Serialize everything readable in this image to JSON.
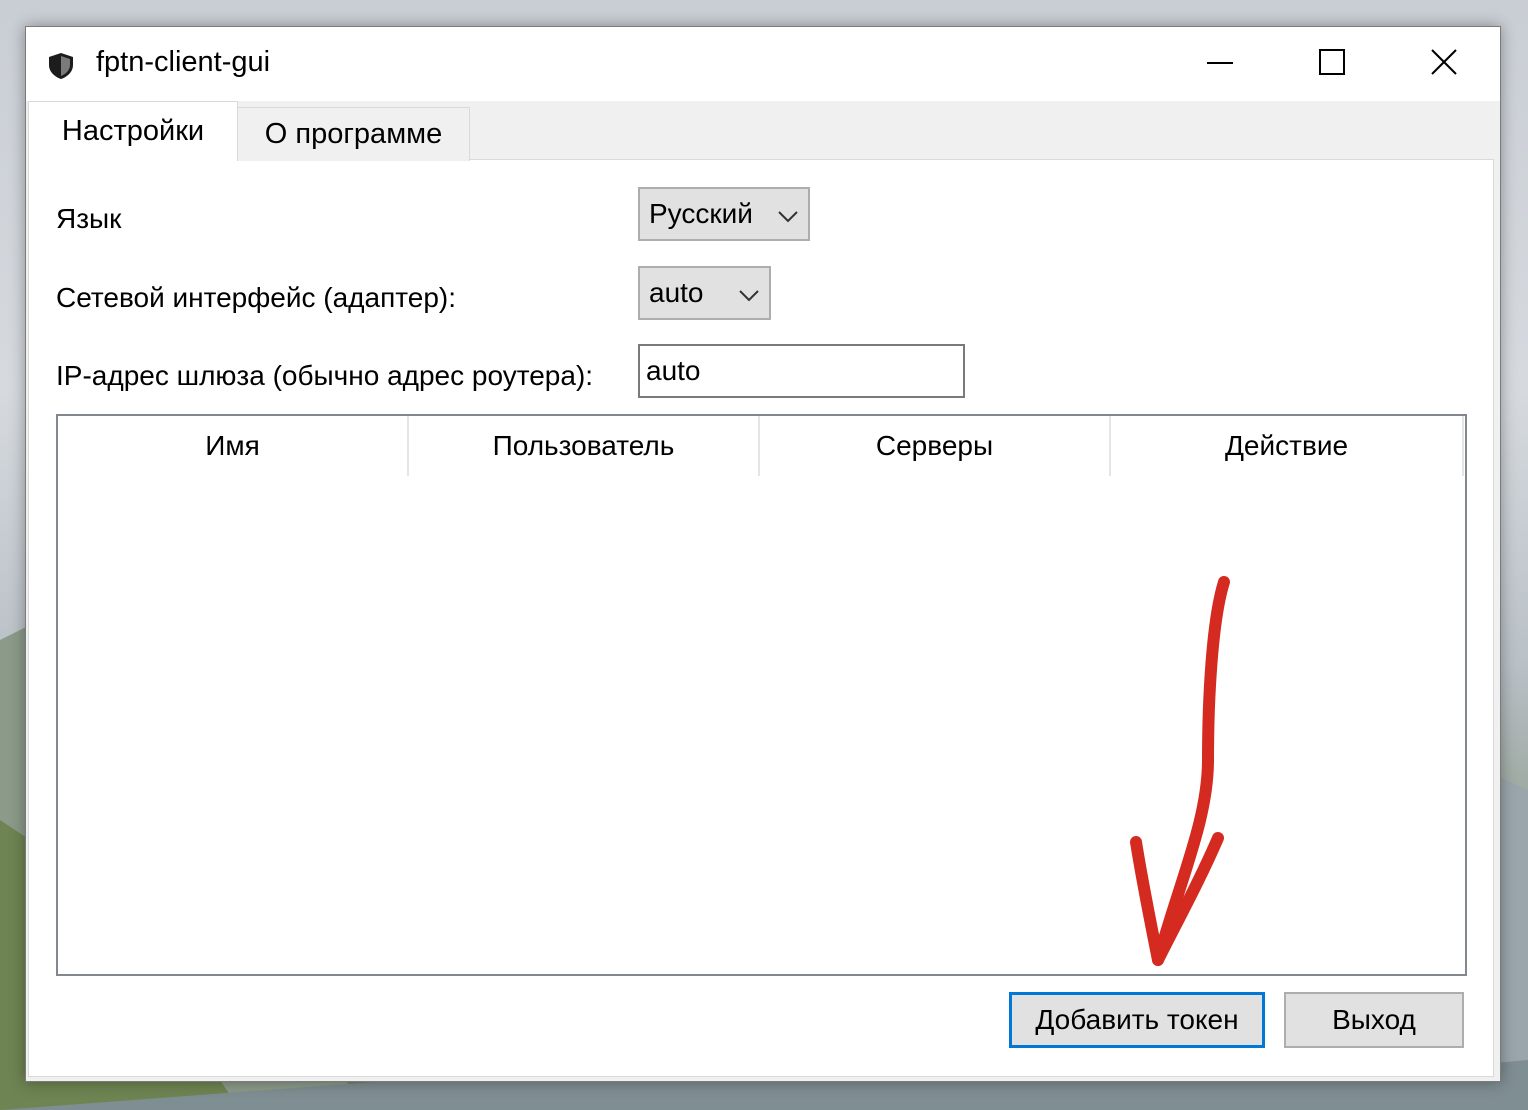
{
  "window": {
    "title": "fptn-client-gui",
    "controls": {
      "minimize": "minimize",
      "maximize": "maximize",
      "close": "close"
    }
  },
  "tabs": [
    {
      "label": "Настройки",
      "active": true
    },
    {
      "label": "О программе",
      "active": false
    }
  ],
  "settings": {
    "language": {
      "label": "Язык",
      "value": "Русский"
    },
    "network_interface": {
      "label": "Сетевой интерфейс (адаптер):",
      "value": "auto"
    },
    "gateway_ip": {
      "label": "IP-адрес шлюза (обычно адрес роутера):",
      "value": "auto"
    }
  },
  "tokens_table": {
    "columns": [
      "Имя",
      "Пользователь",
      "Серверы",
      "Действие"
    ],
    "rows": []
  },
  "buttons": {
    "add_token": "Добавить токен",
    "exit": "Выход"
  },
  "colors": {
    "focus_border": "#0078d7",
    "annotation_arrow": "#d42a1f"
  },
  "icons": {
    "app": "shield-icon",
    "dropdown": "chevron-down-icon"
  }
}
